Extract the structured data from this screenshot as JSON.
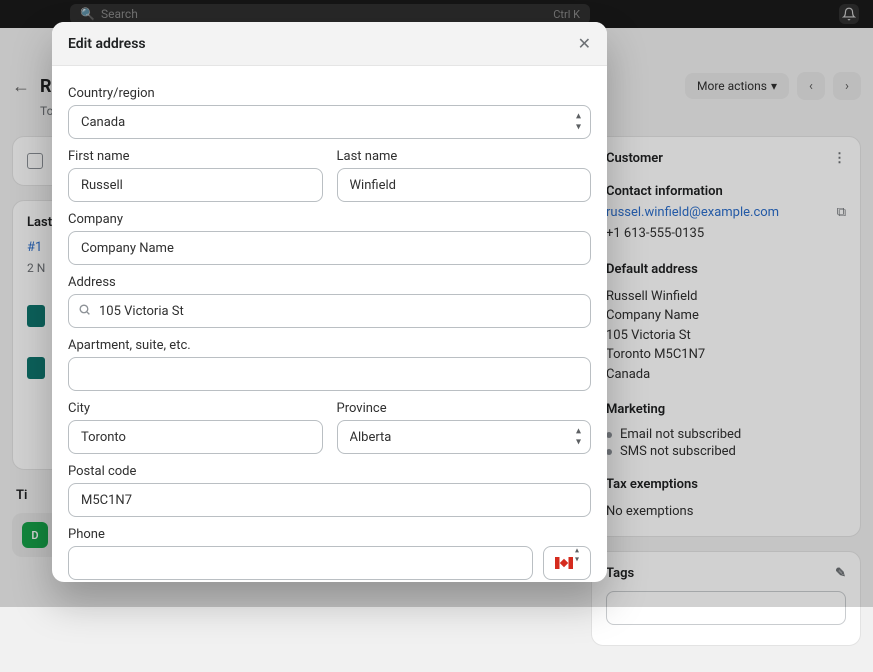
{
  "topbar": {
    "search_placeholder": "Search",
    "shortcut": "Ctrl K"
  },
  "header": {
    "name": "R",
    "location_line": "To",
    "more_actions": "More actions"
  },
  "main": {
    "last_label": "Last",
    "order_id": "#1",
    "order_meta": "2 N"
  },
  "timeline": {
    "heading": "Ti",
    "avatar_initial": "D"
  },
  "side": {
    "customer_heading": "Customer",
    "contact_heading": "Contact information",
    "email": "russel.winfield@example.com",
    "phone": "+1 613-555-0135",
    "default_addr_heading": "Default address",
    "addr_name": "Russell Winfield",
    "addr_company": "Company Name",
    "addr_street": "105 Victoria St",
    "addr_city": "Toronto M5C1N7",
    "addr_country": "Canada",
    "marketing_heading": "Marketing",
    "marketing_email": "Email not subscribed",
    "marketing_sms": "SMS not subscribed",
    "tax_heading": "Tax exemptions",
    "tax_line": "No exemptions",
    "tags_heading": "Tags"
  },
  "modal": {
    "title": "Edit address",
    "labels": {
      "country": "Country/region",
      "first": "First name",
      "last": "Last name",
      "company": "Company",
      "address": "Address",
      "apt": "Apartment, suite, etc.",
      "city": "City",
      "province": "Province",
      "postal": "Postal code",
      "phone": "Phone"
    },
    "values": {
      "country": "Canada",
      "first": "Russell",
      "last": "Winfield",
      "company": "Company Name",
      "address": "105 Victoria St",
      "apt": "",
      "city": "Toronto",
      "province": "Alberta",
      "postal": "M5C1N7",
      "phone": ""
    }
  }
}
